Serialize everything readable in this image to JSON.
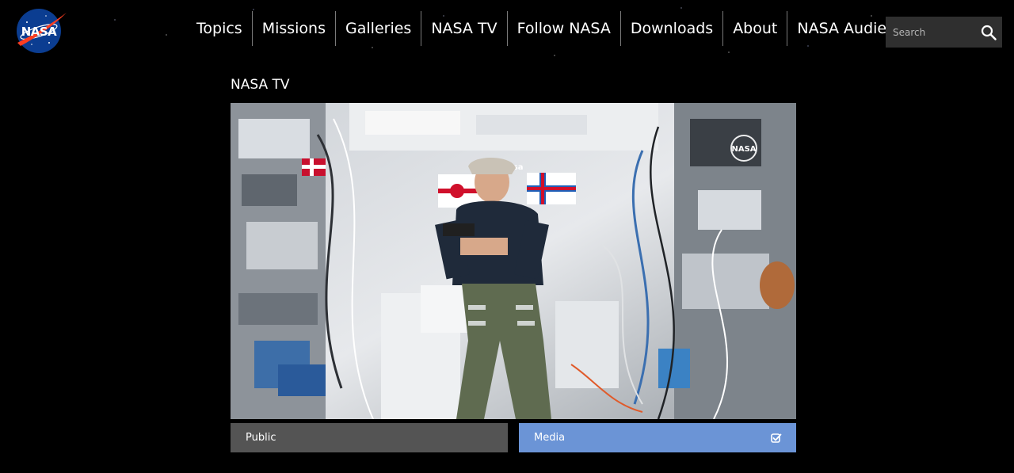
{
  "brand": {
    "logo_text": "NASA",
    "colors": {
      "blue": "#0b3d91",
      "red": "#fc3d21",
      "media_tab": "#6b94d6",
      "public_tab": "#545454"
    }
  },
  "nav": {
    "items": [
      {
        "label": "Topics"
      },
      {
        "label": "Missions"
      },
      {
        "label": "Galleries"
      },
      {
        "label": "NASA TV"
      },
      {
        "label": "Follow NASA"
      },
      {
        "label": "Downloads"
      },
      {
        "label": "About"
      },
      {
        "label": "NASA Audiences"
      }
    ]
  },
  "search": {
    "placeholder": "Search",
    "icon": "search-icon"
  },
  "page": {
    "title": "NASA TV"
  },
  "video": {
    "overlay_logo": "NASA",
    "badge": "esa",
    "icon": "video-frame"
  },
  "tabs": {
    "public": {
      "label": "Public",
      "selected": false
    },
    "media": {
      "label": "Media",
      "selected": true,
      "icon": "checkbox-checked-icon"
    }
  }
}
